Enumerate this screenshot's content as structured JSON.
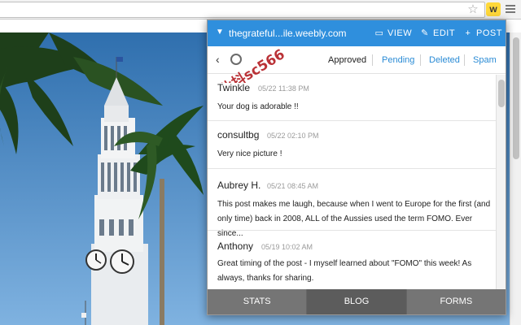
{
  "browser": {
    "extension_badge": "w",
    "icons": {
      "star": "star-icon",
      "menu": "menu-icon"
    }
  },
  "popup": {
    "header": {
      "site": "thegrateful...ile.weebly.com",
      "view_label": "VIEW",
      "edit_label": "EDIT",
      "post_label": "POST",
      "color": "#2f8fdd",
      "icons": {
        "site": "chevron-down-icon",
        "view": "window-icon",
        "edit": "pencil-icon",
        "post": "plus-icon"
      }
    },
    "toolbar": {
      "tabs": [
        {
          "label": "Approved",
          "active": true
        },
        {
          "label": "Pending",
          "active": false
        },
        {
          "label": "Deleted",
          "active": false
        },
        {
          "label": "Spam",
          "active": false
        }
      ],
      "icons": {
        "back": "back-arrow-icon",
        "settings": "gear-icon"
      }
    },
    "comments": [
      {
        "author": "Twinkle",
        "date": "05/22 11:38 PM",
        "text": "Your dog is adorable !!"
      },
      {
        "author": "consultbg",
        "date": "05/22 02:10 PM",
        "text": "Very nice picture !"
      },
      {
        "author": "Aubrey H.",
        "date": "05/21 08:45 AM",
        "text": "This post makes me laugh, because when I went to Europe for the first (and only time) back in 2008, ALL of the Aussies used the term FOMO. Ever since..."
      },
      {
        "author": "Anthony",
        "date": "05/19 10:02 AM",
        "text": "Great timing of the post - I myself learned about \"FOMO\" this week! As always, thanks for sharing."
      }
    ],
    "bottom_tabs": [
      {
        "label": "STATS",
        "active": false
      },
      {
        "label": "BLOG",
        "active": true
      },
      {
        "label": "FORMS",
        "active": false
      }
    ]
  },
  "watermark": {
    "text": "以此抖sc566",
    "color": "#b0161b"
  }
}
